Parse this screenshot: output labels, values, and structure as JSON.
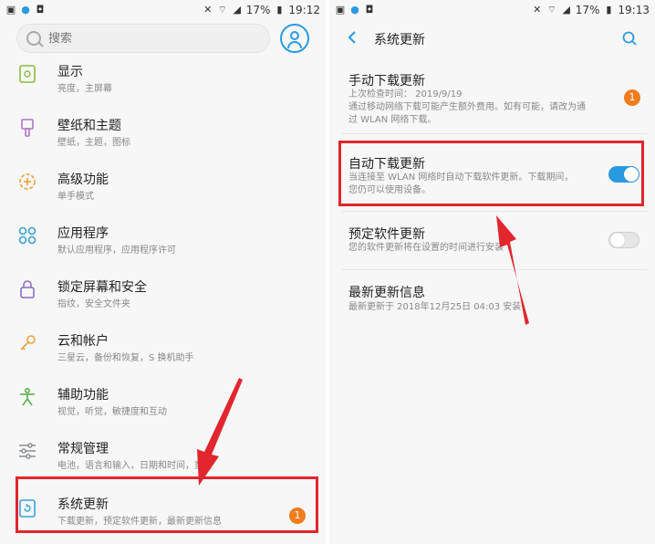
{
  "status_bar": {
    "left_panel_time": "19:12",
    "right_panel_time": "19:13",
    "battery": "17%"
  },
  "left": {
    "search": {
      "placeholder": "搜索"
    },
    "menu_items": [
      {
        "title": "显示",
        "subtitle": "亮度，主屏幕",
        "icon": "display-icon"
      },
      {
        "title": "壁纸和主题",
        "subtitle": "壁纸，主题，图标",
        "icon": "brush-icon"
      },
      {
        "title": "高级功能",
        "subtitle": "单手模式",
        "icon": "gear-plus-icon"
      },
      {
        "title": "应用程序",
        "subtitle": "默认应用程序，应用程序许可",
        "icon": "apps-grid-icon"
      },
      {
        "title": "锁定屏幕和安全",
        "subtitle": "指纹，安全文件夹",
        "icon": "lock-icon"
      },
      {
        "title": "云和帐户",
        "subtitle": "三星云，备份和恢复，S 换机助手",
        "icon": "key-icon"
      },
      {
        "title": "辅助功能",
        "subtitle": "视觉，听觉，敏捷度和互动",
        "icon": "accessibility-icon"
      },
      {
        "title": "常规管理",
        "subtitle": "电池，语言和输入，日期和时间，重置",
        "icon": "sliders-icon"
      },
      {
        "title": "系统更新",
        "subtitle": "下载更新，预定软件更新，最新更新信息",
        "icon": "update-icon",
        "badge": "1"
      }
    ]
  },
  "right": {
    "title": "系统更新",
    "settings": [
      {
        "title": "手动下载更新",
        "subtitle_lines": [
          "上次检查时间： 2019/9/19",
          "通过移动网络下载可能产生额外费用。如有可能，请改为通",
          "过 WLAN 网络下载。"
        ],
        "badge": "1"
      },
      {
        "title": "自动下载更新",
        "subtitle_lines": [
          "当连接至 WLAN 网络时自动下载软件更新。下载期间，",
          "您仍可以使用设备。"
        ],
        "toggle": "on"
      },
      {
        "title": "预定软件更新",
        "subtitle_lines": [
          "您的软件更新将在设置的时间进行安装"
        ],
        "toggle": "off"
      },
      {
        "title": "最新更新信息",
        "subtitle_lines": [
          "最新更新于 2018年12月25日 04:03 安装"
        ]
      }
    ]
  },
  "colors": {
    "accent": "#2a9ae0",
    "badge": "#f07c1e",
    "highlight": "#e1262d"
  }
}
